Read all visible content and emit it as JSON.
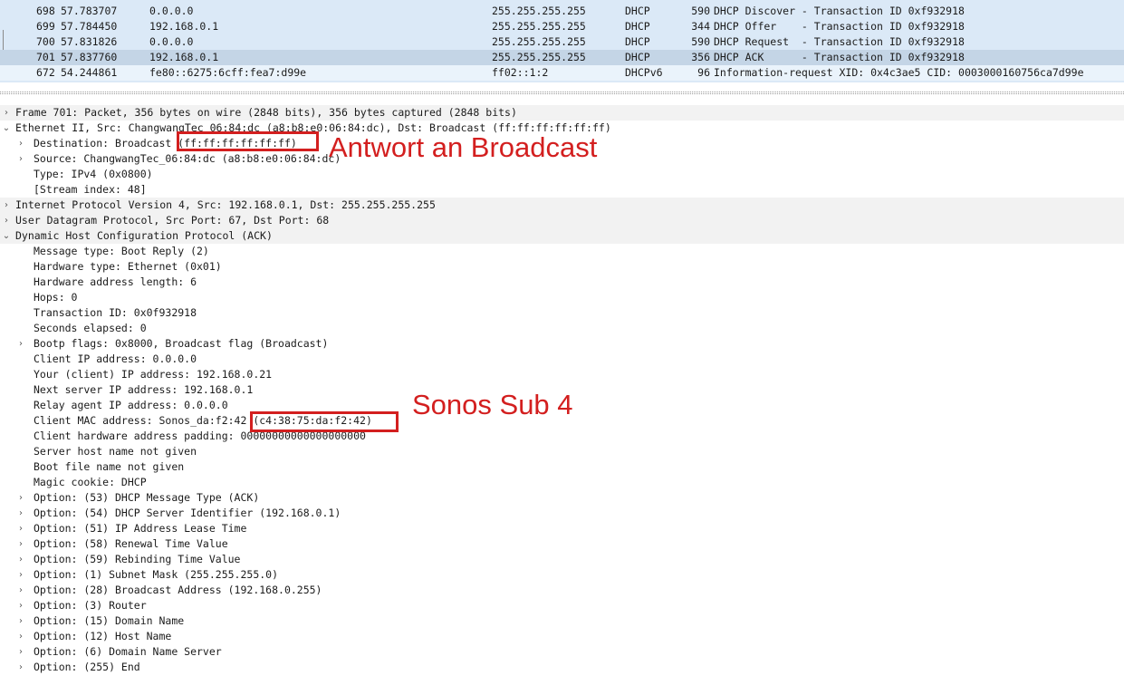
{
  "packets": [
    {
      "no": "698",
      "time": "57.783707",
      "source": "0.0.0.0",
      "destination": "255.255.255.255",
      "protocol": "DHCP",
      "length": "590",
      "info": "DHCP Discover - Transaction ID 0xf932918"
    },
    {
      "no": "699",
      "time": "57.784450",
      "source": "192.168.0.1",
      "destination": "255.255.255.255",
      "protocol": "DHCP",
      "length": "344",
      "info": "DHCP Offer    - Transaction ID 0xf932918"
    },
    {
      "no": "700",
      "time": "57.831826",
      "source": "0.0.0.0",
      "destination": "255.255.255.255",
      "protocol": "DHCP",
      "length": "590",
      "info": "DHCP Request  - Transaction ID 0xf932918"
    },
    {
      "no": "701",
      "time": "57.837760",
      "source": "192.168.0.1",
      "destination": "255.255.255.255",
      "protocol": "DHCP",
      "length": "356",
      "info": "DHCP ACK      - Transaction ID 0xf932918"
    },
    {
      "no": "672",
      "time": "54.244861",
      "source": "fe80::6275:6cff:fea7:d99e",
      "destination": "ff02::1:2",
      "protocol": "DHCPv6",
      "length": "96",
      "info": "Information-request XID: 0x4c3ae5 CID: 0003000160756ca7d99e"
    }
  ],
  "detail": [
    "Frame 701: Packet, 356 bytes on wire (2848 bits), 356 bytes captured (2848 bits)",
    "Ethernet II, Src: ChangwangTec_06:84:dc (a8:b8:e0:06:84:dc), Dst: Broadcast (ff:ff:ff:ff:ff:ff)",
    "Destination: Broadcast (ff:ff:ff:ff:ff:ff)",
    "Source: ChangwangTec_06:84:dc (a8:b8:e0:06:84:dc)",
    "Type: IPv4 (0x0800)",
    "[Stream index: 48]",
    "Internet Protocol Version 4, Src: 192.168.0.1, Dst: 255.255.255.255",
    "User Datagram Protocol, Src Port: 67, Dst Port: 68",
    "Dynamic Host Configuration Protocol (ACK)",
    "Message type: Boot Reply (2)",
    "Hardware type: Ethernet (0x01)",
    "Hardware address length: 6",
    "Hops: 0",
    "Transaction ID: 0x0f932918",
    "Seconds elapsed: 0",
    "Bootp flags: 0x8000, Broadcast flag (Broadcast)",
    "Client IP address: 0.0.0.0",
    "Your (client) IP address: 192.168.0.21",
    "Next server IP address: 192.168.0.1",
    "Relay agent IP address: 0.0.0.0",
    "Client MAC address: Sonos_da:f2:42 (c4:38:75:da:f2:42)",
    "Client hardware address padding: 00000000000000000000",
    "Server host name not given",
    "Boot file name not given",
    "Magic cookie: DHCP",
    "Option: (53) DHCP Message Type (ACK)",
    "Option: (54) DHCP Server Identifier (192.168.0.1)",
    "Option: (51) IP Address Lease Time",
    "Option: (58) Renewal Time Value",
    "Option: (59) Rebinding Time Value",
    "Option: (1) Subnet Mask (255.255.255.0)",
    "Option: (28) Broadcast Address (192.168.0.255)",
    "Option: (3) Router",
    "Option: (15) Domain Name",
    "Option: (12) Host Name",
    "Option: (6) Domain Name Server",
    "Option: (255) End"
  ],
  "annotations": {
    "broadcast": "Antwort an Broadcast",
    "sonos": "Sonos Sub 4"
  },
  "colors": {
    "annotation": "#d31f1f",
    "packet_bg": "#dbe9f7",
    "selected_bg": "#c4d5e6"
  }
}
